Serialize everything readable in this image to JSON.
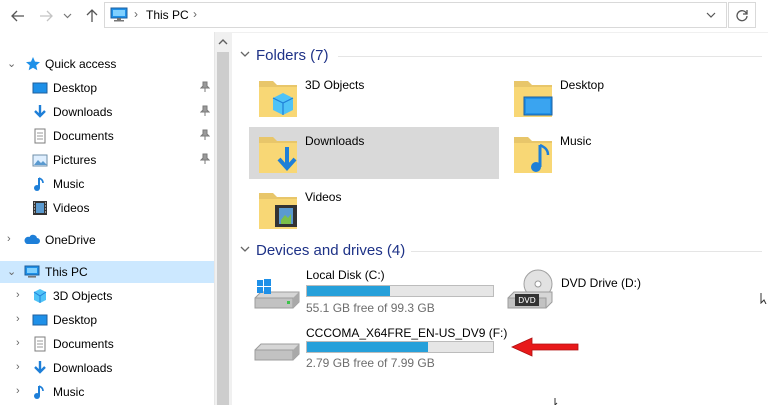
{
  "address": {
    "crumbs": [
      "This PC"
    ]
  },
  "sidebar": {
    "quick_access": "Quick access",
    "quick_items": [
      {
        "label": "Desktop",
        "icon": "desktop-icon",
        "pinned": true
      },
      {
        "label": "Downloads",
        "icon": "downloads-icon",
        "pinned": true
      },
      {
        "label": "Documents",
        "icon": "documents-icon",
        "pinned": true
      },
      {
        "label": "Pictures",
        "icon": "pictures-icon",
        "pinned": true
      },
      {
        "label": "Music",
        "icon": "music-icon",
        "pinned": false
      },
      {
        "label": "Videos",
        "icon": "videos-icon",
        "pinned": false
      }
    ],
    "onedrive": "OneDrive",
    "this_pc": "This PC",
    "pc_items": [
      {
        "label": "3D Objects",
        "icon": "3d-objects-icon"
      },
      {
        "label": "Desktop",
        "icon": "desktop-icon"
      },
      {
        "label": "Documents",
        "icon": "documents-icon"
      },
      {
        "label": "Downloads",
        "icon": "downloads-icon"
      },
      {
        "label": "Music",
        "icon": "music-icon"
      }
    ]
  },
  "main": {
    "folders_title": "Folders (7)",
    "folders": [
      {
        "label": "3D Objects",
        "icon": "3d-objects-folder-icon",
        "selected": false
      },
      {
        "label": "Desktop",
        "icon": "desktop-folder-icon",
        "selected": false
      },
      {
        "label": "Downloads",
        "icon": "downloads-folder-icon",
        "selected": true
      },
      {
        "label": "Music",
        "icon": "music-folder-icon",
        "selected": false
      },
      {
        "label": "Videos",
        "icon": "videos-folder-icon",
        "selected": false
      }
    ],
    "devices_title": "Devices and drives (4)",
    "drives": [
      {
        "name": "Local Disk (C:)",
        "free": "55.1 GB free of 99.3 GB",
        "used_fraction": 0.445,
        "icon": "windows-drive-icon"
      },
      {
        "name": "DVD Drive (D:)",
        "icon": "dvd-drive-icon"
      },
      {
        "name": "CCCOMA_X64FRE_EN-US_DV9 (F:)",
        "free": "2.79 GB free of 7.99 GB",
        "used_fraction": 0.651,
        "icon": "drive-icon"
      }
    ]
  },
  "colors": {
    "accent": "#26a0da",
    "section_title": "#1e3287",
    "selection": "#cce8ff",
    "arrow": "#e8191a"
  }
}
